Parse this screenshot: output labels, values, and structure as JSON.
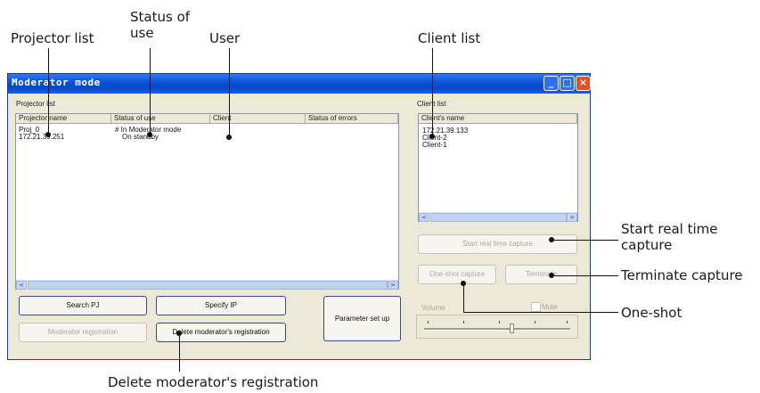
{
  "callouts": {
    "projector_list": "Projector list",
    "status_of_use_1": "Status of",
    "status_of_use_2": "use",
    "user": "User",
    "client_list": "Client list",
    "start_rt_1": "Start real time",
    "start_rt_2": "capture",
    "terminate": "Terminate capture",
    "one_shot": "One-shot",
    "delete_reg": "Delete moderator's registration"
  },
  "window": {
    "title": "Moderator mode",
    "minimize": "_",
    "maximize": "□",
    "close": "×"
  },
  "projector_list": {
    "label": "Projector list",
    "columns": [
      "Projector name",
      "Status of use",
      "Client",
      "Status of errors"
    ],
    "rows": [
      {
        "name": "Proj_0",
        "status": "# In Moderator mode"
      },
      {
        "name": "172.21.39.251",
        "status": "On standby"
      }
    ]
  },
  "client_list": {
    "label": "Client list",
    "column": "Client's name",
    "items": [
      "172.21.39.133",
      "Client-2",
      "Client-1"
    ]
  },
  "buttons": {
    "search_pj": "Search PJ",
    "specify_ip": "Specify IP",
    "moderator_registration": "Moderator registration",
    "delete_registration": "Delete moderator's registration",
    "parameter_set_up": "Parameter set up",
    "start_realtime": "Start real time capture",
    "one_shot": "One-shot capture",
    "terminate": "Terminate"
  },
  "volume": {
    "label": "Volume",
    "mute_label": "Mute",
    "level": 0.6
  },
  "scroll_arrows": {
    "left": "<",
    "right": ">"
  }
}
